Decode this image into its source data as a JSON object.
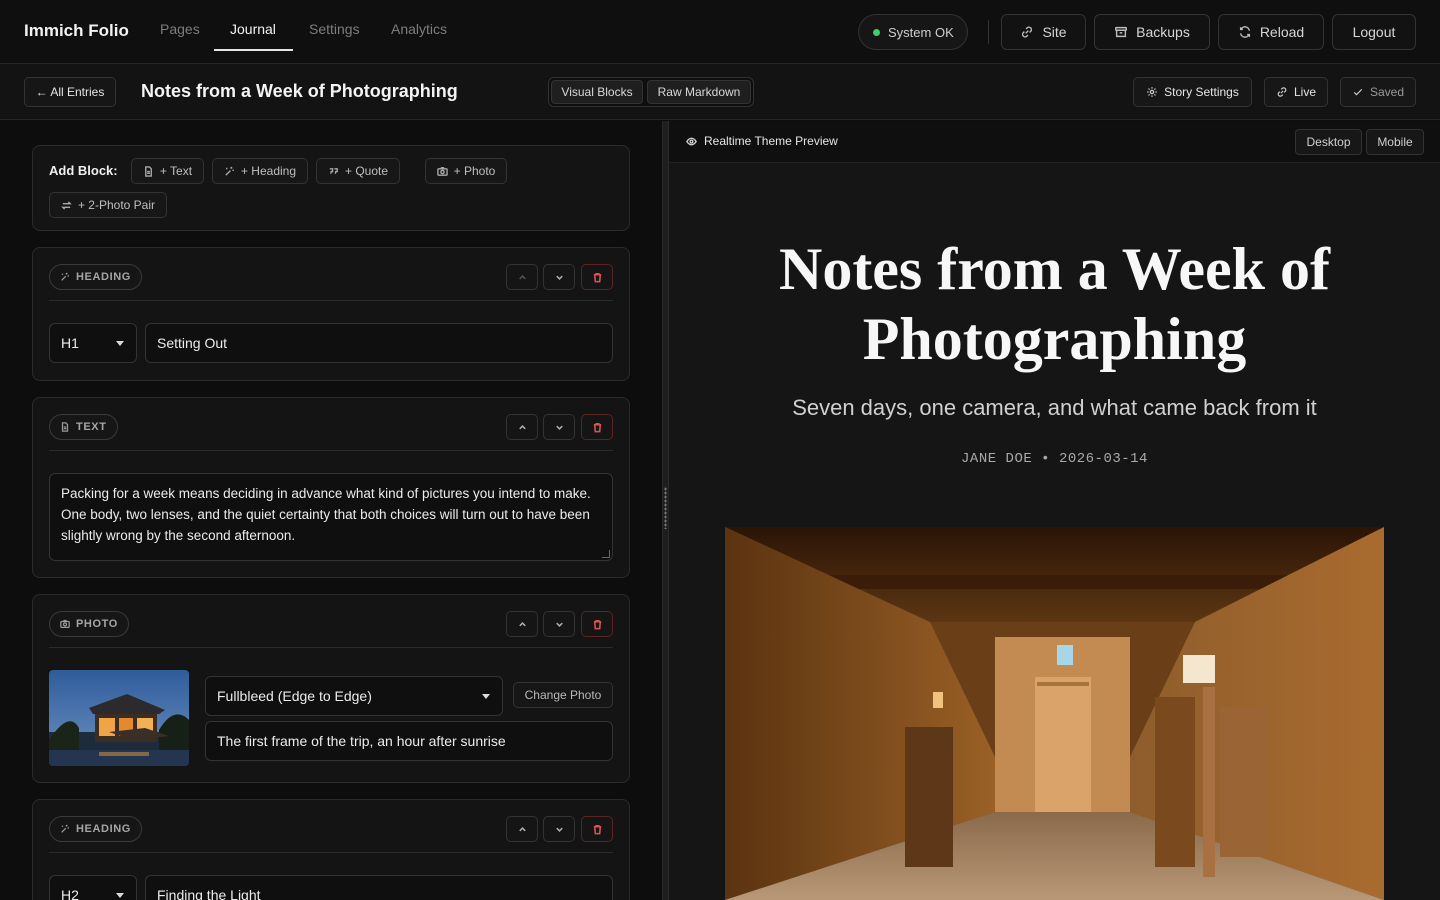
{
  "app": {
    "brand": "Immich Folio",
    "nav_tabs": [
      {
        "label": "Pages"
      },
      {
        "label": "Journal"
      },
      {
        "label": "Settings"
      },
      {
        "label": "Analytics"
      }
    ],
    "status": "System OK",
    "actions": {
      "site": "Site",
      "backups": "Backups",
      "reload": "Reload",
      "logout": "Logout"
    }
  },
  "toolbar": {
    "back": "← All Entries",
    "title": "Notes from a Week of Photographing",
    "mode_visual": "Visual Blocks",
    "mode_raw": "Raw Markdown",
    "story_settings": "Story Settings",
    "live": "Live",
    "saved": "Saved"
  },
  "add_block": {
    "label": "Add Block:",
    "text": "+ Text",
    "heading": "+ Heading",
    "quote": "+ Quote",
    "photo": "+ Photo",
    "pair": "+ 2-Photo Pair"
  },
  "blocks": [
    {
      "type": "HEADING",
      "level": "H1",
      "text": "Setting Out"
    },
    {
      "type": "TEXT",
      "body": "Packing for a week means deciding in advance what kind of pictures you intend to make. One body, two lenses, and the quiet certainty that both choices will turn out to have been slightly wrong by the second afternoon."
    },
    {
      "type": "PHOTO",
      "layout": "Fullbleed (Edge to Edge)",
      "change": "Change Photo",
      "caption": "The first frame of the trip, an hour after sunrise"
    },
    {
      "type": "HEADING",
      "level": "H2",
      "text": "Finding the Light"
    }
  ],
  "preview": {
    "label": "Realtime Theme Preview",
    "desktop": "Desktop",
    "mobile": "Mobile",
    "title": "Notes from a Week of Photographing",
    "subtitle": "Seven days, one camera, and what came back from it",
    "meta": "JANE DOE • 2026-03-14"
  }
}
